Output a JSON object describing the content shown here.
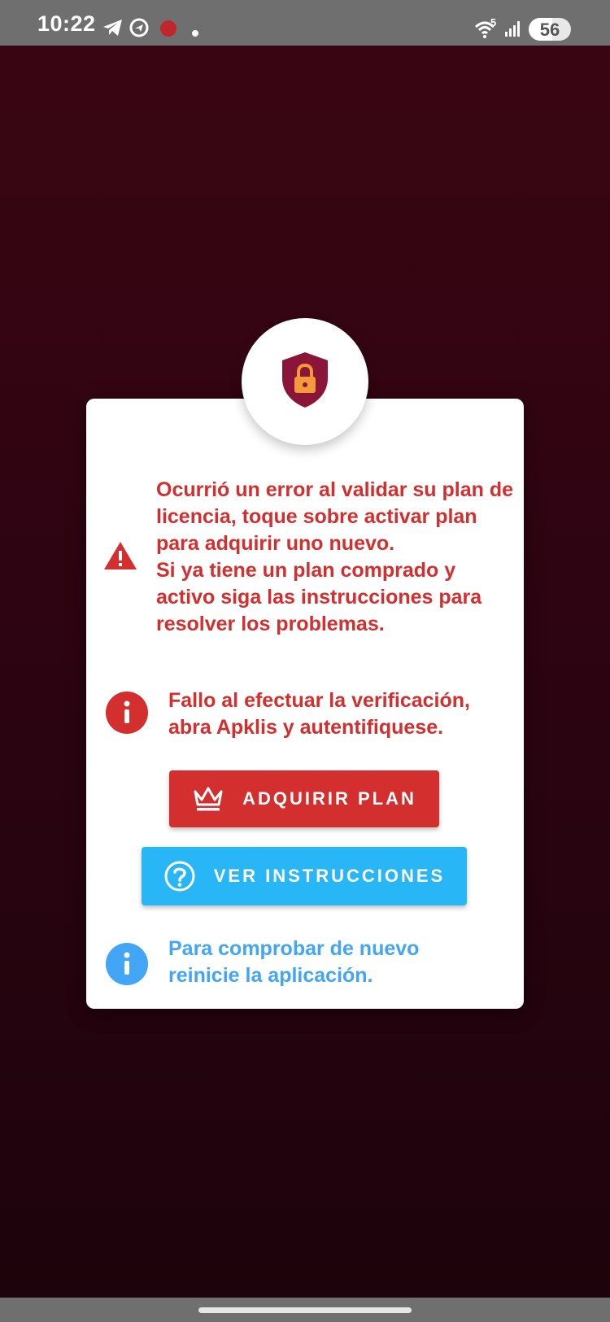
{
  "status_bar": {
    "time": "10:22",
    "network_label": "5",
    "battery_level": "56",
    "battery_fraction": 0.56
  },
  "icons": {
    "telegram": "telegram-icon",
    "app_circle": "app-circle-icon",
    "notification": "notification-dot-icon",
    "wifi": "wifi-icon",
    "signal": "signal-icon",
    "battery": "battery-icon",
    "shield": "shield-lock-icon",
    "warning": "warning-icon",
    "error_info": "error-info-icon",
    "crown": "crown-icon",
    "question": "question-icon",
    "info": "info-icon"
  },
  "dialog": {
    "error_message": "Ocurrió un error al validar su plan de licencia, toque sobre activar plan para adquirir uno nuevo.\nSi ya tiene un plan comprado y activo siga las instrucciones para resolver los problemas.",
    "verification_message": "Fallo al efectuar la verificación, abra Apklis y autentifiquese.",
    "buy_button_label": "ADQUIRIR PLAN",
    "instructions_button_label": "VER INSTRUCCIONES",
    "restart_message": "Para comprobar de nuevo reinicie la aplicación."
  },
  "colors": {
    "error_red": "#d32f2f",
    "info_blue": "#42a5f5",
    "button_blue": "#29b6f6",
    "shield": "#8b1538",
    "lock": "#f59a3c"
  }
}
